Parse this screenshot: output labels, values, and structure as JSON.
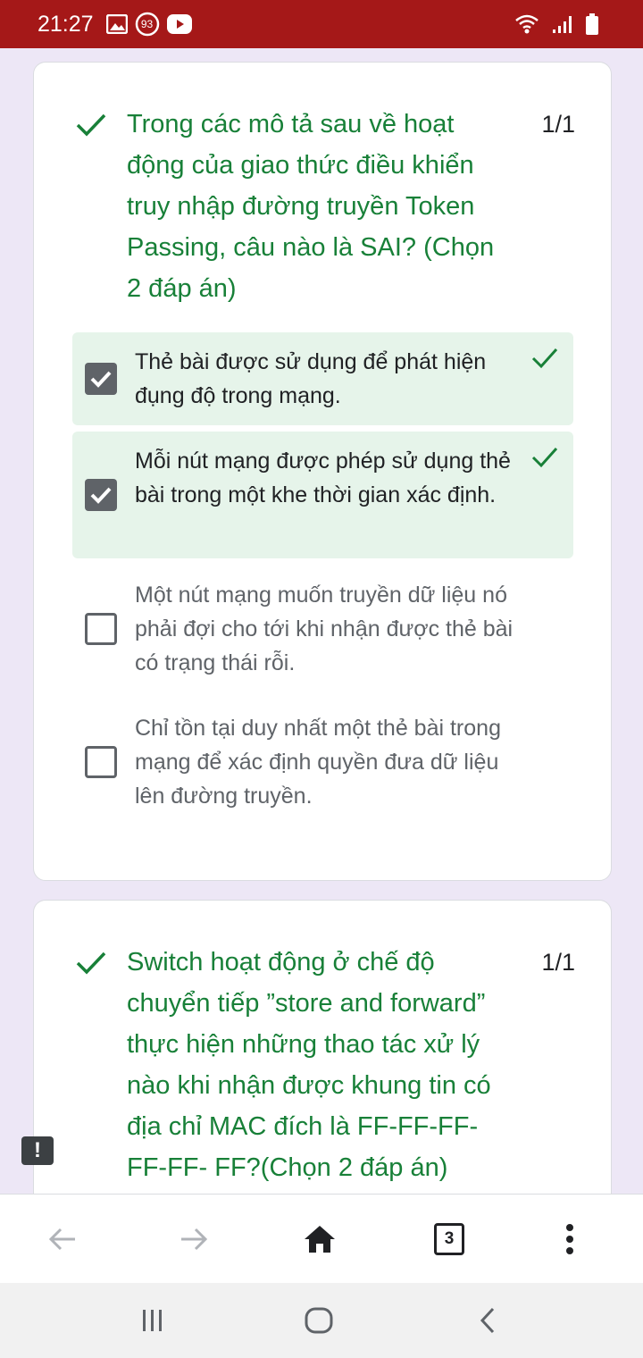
{
  "status_bar": {
    "time": "21:27",
    "notification_badge": "93",
    "icons": [
      "image-icon",
      "notification-badge-icon",
      "youtube-icon",
      "wifi-icon",
      "signal-icon",
      "battery-icon"
    ]
  },
  "questions": [
    {
      "text": "Trong các mô tả sau về hoạt động của giao thức điều khiển truy nhập đường truyền Token Passing, câu nào là SAI? (Chọn 2 đáp án)",
      "score": "1/1",
      "options": [
        {
          "text": "Thẻ bài được sử dụng để phát hiện đụng độ trong mạng.",
          "checked": true,
          "correct": true
        },
        {
          "text": "Mỗi nút mạng được phép sử dụng thẻ bài trong một khe thời gian xác định.",
          "checked": true,
          "correct": true
        },
        {
          "text": "Một nút mạng muốn truyền dữ liệu nó phải đợi cho tới khi nhận được thẻ bài có trạng thái rỗi.",
          "checked": false,
          "correct": false
        },
        {
          "text": "Chỉ tồn tại duy nhất một thẻ bài trong mạng để xác định quyền đưa dữ liệu lên đường truyền.",
          "checked": false,
          "correct": false
        }
      ]
    },
    {
      "text": "Switch hoạt động ở chế độ chuyển tiếp ”store and forward” thực hiện những thao tác xử lý nào khi nhận được khung tin có địa chỉ MAC đích là FF-FF-FF-FF-FF- FF?(Chọn 2 đáp án)",
      "score": "1/1"
    }
  ],
  "toolbar": {
    "tab_count": "3"
  },
  "colors": {
    "status_bar": "#a51818",
    "correct_green": "#188038",
    "correct_bg": "#e6f4ea",
    "page_bg": "#ede7f6"
  }
}
